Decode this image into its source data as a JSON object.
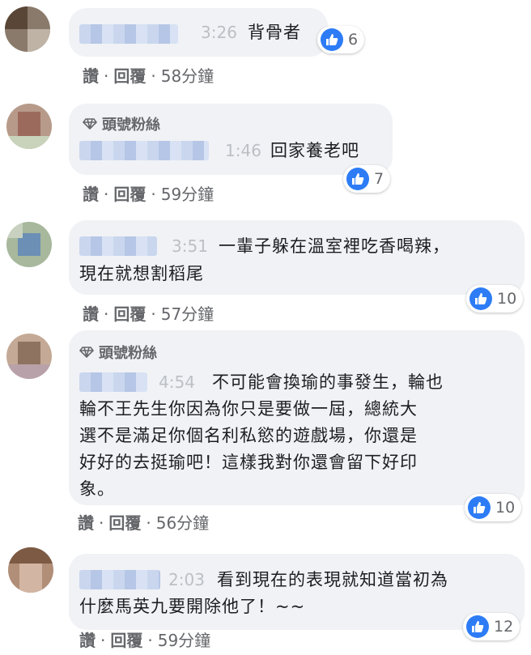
{
  "comments": [
    {
      "time": "3:26",
      "text": [
        "背骨者"
      ],
      "likes": "6",
      "actions": {
        "like": "讚",
        "reply": "回覆",
        "age": "58分鐘"
      }
    },
    {
      "badge": "頭號粉絲",
      "time": "1:46",
      "text": [
        "回家養老吧"
      ],
      "likes": "7",
      "actions": {
        "like": "讚",
        "reply": "回覆",
        "age": "59分鐘"
      }
    },
    {
      "time": "3:51",
      "text": [
        "一輩子躲在溫室裡吃香喝辣，",
        "現在就想割稻尾"
      ],
      "likes": "10",
      "actions": {
        "like": "讚",
        "reply": "回覆",
        "age": "57分鐘"
      }
    },
    {
      "badge": "頭號粉絲",
      "time": "4:54",
      "text": [
        "不可能會換瑜的事發生，輪也",
        "輪不王先生你因為你只是要做一屆，總統大",
        "選不是滿足你個名利私慾的遊戲場，你還是",
        "好好的去挺瑜吧！這樣我對你還會留下好印",
        "象。"
      ],
      "likes": "10",
      "actions": {
        "like": "讚",
        "reply": "回覆",
        "age": "56分鐘"
      }
    },
    {
      "time": "2:03",
      "text": [
        "看到現在的表現就知道當初為",
        "什麼馬英九要開除他了！~~"
      ],
      "likes": "12",
      "actions": {
        "like": "讚",
        "reply": "回覆",
        "age": "59分鐘"
      }
    }
  ],
  "colors": {
    "bubble": "#f0f2f5",
    "like": "#2d7cf6",
    "muted": "#65676b",
    "time": "#bcc0c4"
  },
  "icons": {
    "like": "thumbs-up-icon",
    "badge": "diamond-icon"
  }
}
